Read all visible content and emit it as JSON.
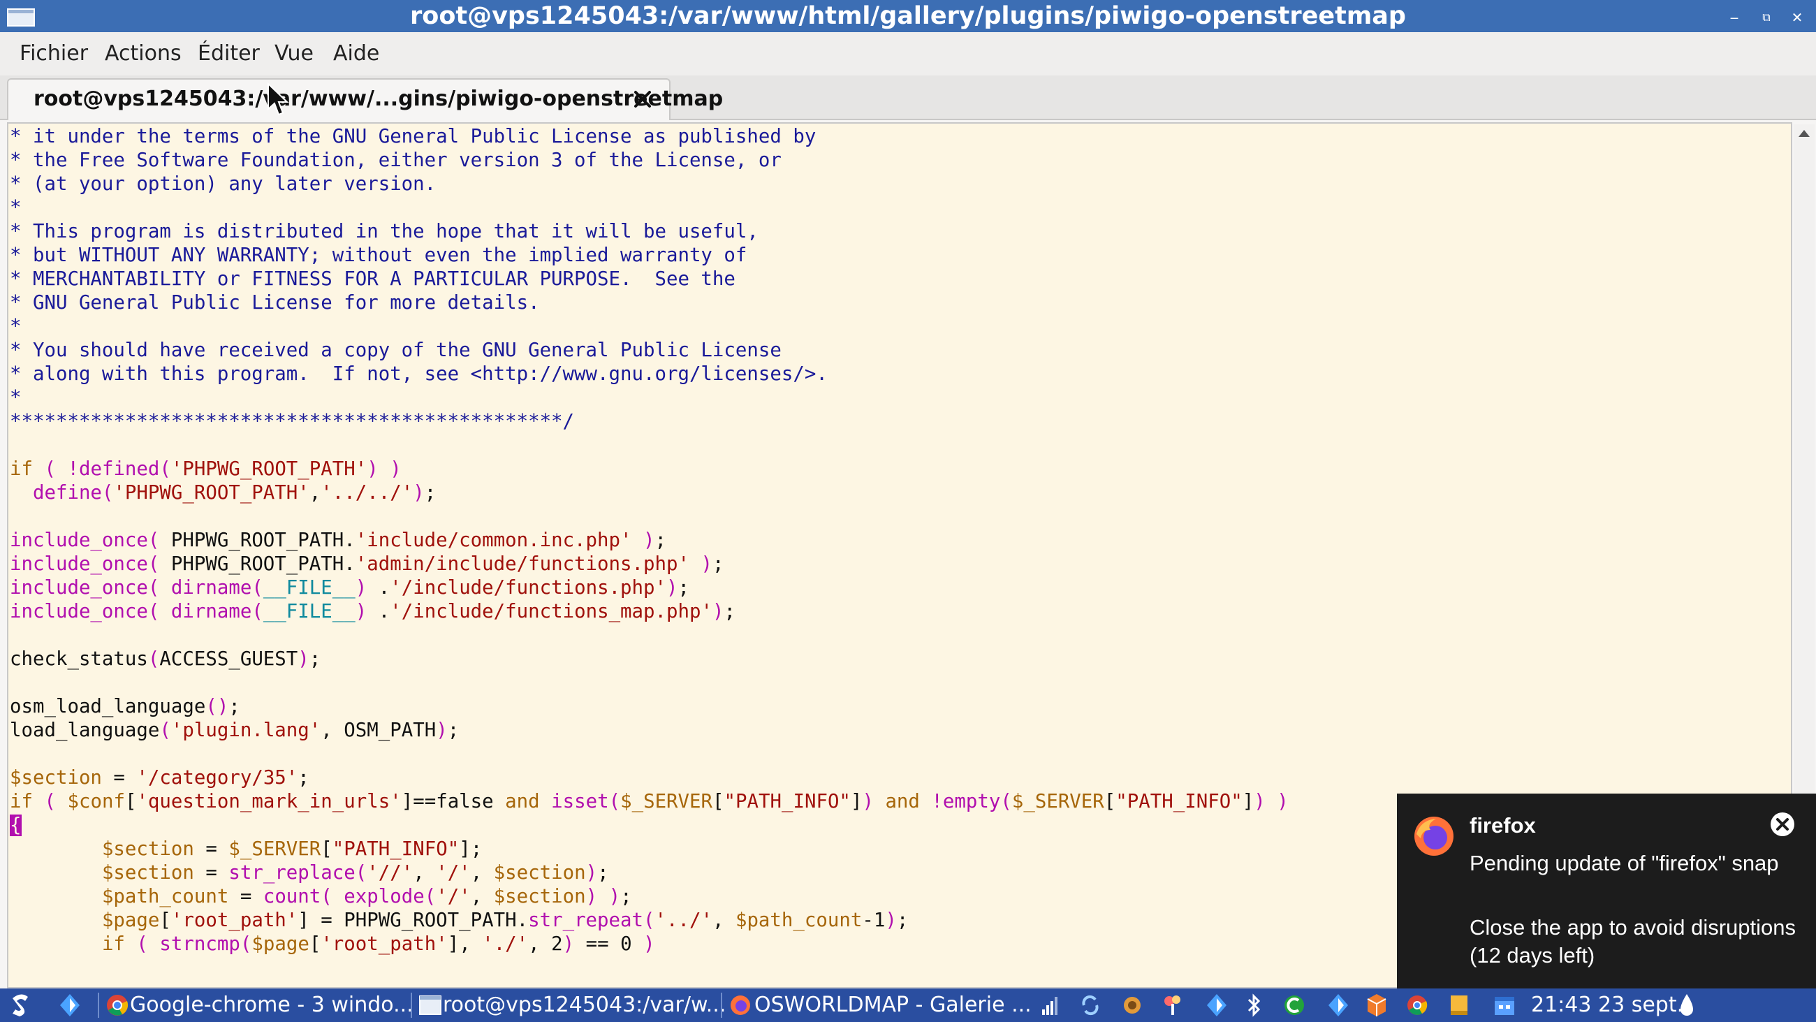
{
  "window": {
    "title": "root@vps1245043:/var/www/html/gallery/plugins/piwigo-openstreetmap"
  },
  "menu": [
    "Fichier",
    "Actions",
    "Éditer",
    "Vue",
    "Aide"
  ],
  "tab": {
    "label": "root@vps1245043:/var/www/...gins/piwigo-openstreetmap"
  },
  "colors": {
    "titlebar": "#3c6eb4",
    "terminal_bg": "#fdf6e3",
    "taskbar": "#2a4ea0",
    "notification_bg": "#1c1c1c"
  },
  "code_lines": [
    [
      [
        "c",
        "* it under the terms of the GNU General Public License as published by"
      ]
    ],
    [
      [
        "c",
        "* the Free Software Foundation, either version 3 of the License, or"
      ]
    ],
    [
      [
        "c",
        "* (at your option) any later version."
      ]
    ],
    [
      [
        "c",
        "*"
      ]
    ],
    [
      [
        "c",
        "* This program is distributed in the hope that it will be useful,"
      ]
    ],
    [
      [
        "c",
        "* but WITHOUT ANY WARRANTY; without even the implied warranty of"
      ]
    ],
    [
      [
        "c",
        "* MERCHANTABILITY or FITNESS FOR A PARTICULAR PURPOSE.  See the"
      ]
    ],
    [
      [
        "c",
        "* GNU General Public License for more details."
      ]
    ],
    [
      [
        "c",
        "*"
      ]
    ],
    [
      [
        "c",
        "* You should have received a copy of the GNU General Public License"
      ]
    ],
    [
      [
        "c",
        "* along with this program.  If not, see <http://www.gnu.org/licenses/>."
      ]
    ],
    [
      [
        "c",
        "*"
      ]
    ],
    [
      [
        "c",
        "************************************************/"
      ]
    ],
    [
      [
        "p",
        ""
      ]
    ],
    [
      [
        "k",
        "if"
      ],
      [
        "p",
        " "
      ],
      [
        "f",
        "("
      ],
      [
        "p",
        " "
      ],
      [
        "f",
        "!defined("
      ],
      [
        "s",
        "'PHPWG_ROOT_PATH'"
      ],
      [
        "f",
        ")"
      ],
      [
        "p",
        " "
      ],
      [
        "f",
        ")"
      ]
    ],
    [
      [
        "p",
        "  "
      ],
      [
        "f",
        "define("
      ],
      [
        "s",
        "'PHPWG_ROOT_PATH'"
      ],
      [
        "p",
        ","
      ],
      [
        "s",
        "'../../'"
      ],
      [
        "f",
        ")"
      ],
      [
        "p",
        ";"
      ]
    ],
    [
      [
        "p",
        ""
      ]
    ],
    [
      [
        "f",
        "include_once("
      ],
      [
        "p",
        " PHPWG_ROOT_PATH."
      ],
      [
        "s",
        "'include/common.inc.php'"
      ],
      [
        "p",
        " "
      ],
      [
        "f",
        ")"
      ],
      [
        "p",
        ";"
      ]
    ],
    [
      [
        "f",
        "include_once("
      ],
      [
        "p",
        " PHPWG_ROOT_PATH."
      ],
      [
        "s",
        "'admin/include/functions.php'"
      ],
      [
        "p",
        " "
      ],
      [
        "f",
        ")"
      ],
      [
        "p",
        ";"
      ]
    ],
    [
      [
        "f",
        "include_once("
      ],
      [
        "p",
        " "
      ],
      [
        "f",
        "dirname("
      ],
      [
        "b",
        "__FILE__"
      ],
      [
        "f",
        ")"
      ],
      [
        "p",
        " ."
      ],
      [
        "s",
        "'/include/functions.php'"
      ],
      [
        "f",
        ")"
      ],
      [
        "p",
        ";"
      ]
    ],
    [
      [
        "f",
        "include_once("
      ],
      [
        "p",
        " "
      ],
      [
        "f",
        "dirname("
      ],
      [
        "b",
        "__FILE__"
      ],
      [
        "f",
        ")"
      ],
      [
        "p",
        " ."
      ],
      [
        "s",
        "'/include/functions_map.php'"
      ],
      [
        "f",
        ")"
      ],
      [
        "p",
        ";"
      ]
    ],
    [
      [
        "p",
        ""
      ]
    ],
    [
      [
        "p",
        "check_status"
      ],
      [
        "f",
        "("
      ],
      [
        "p",
        "ACCESS_GUEST"
      ],
      [
        "f",
        ")"
      ],
      [
        "p",
        ";"
      ]
    ],
    [
      [
        "p",
        ""
      ]
    ],
    [
      [
        "p",
        "osm_load_language"
      ],
      [
        "f",
        "()"
      ],
      [
        "p",
        ";"
      ]
    ],
    [
      [
        "p",
        "load_language"
      ],
      [
        "f",
        "("
      ],
      [
        "s",
        "'plugin.lang'"
      ],
      [
        "p",
        ", OSM_PATH"
      ],
      [
        "f",
        ")"
      ],
      [
        "p",
        ";"
      ]
    ],
    [
      [
        "p",
        ""
      ]
    ],
    [
      [
        "v",
        "$section"
      ],
      [
        "p",
        " = "
      ],
      [
        "s",
        "'/category/35'"
      ],
      [
        "p",
        ";"
      ]
    ],
    [
      [
        "k",
        "if"
      ],
      [
        "p",
        " "
      ],
      [
        "f",
        "("
      ],
      [
        "p",
        " "
      ],
      [
        "v",
        "$conf"
      ],
      [
        "p",
        "["
      ],
      [
        "s",
        "'question_mark_in_urls'"
      ],
      [
        "p",
        "]==false "
      ],
      [
        "k",
        "and"
      ],
      [
        "p",
        " "
      ],
      [
        "f",
        "isset("
      ],
      [
        "v",
        "$_SERVER"
      ],
      [
        "p",
        "["
      ],
      [
        "s",
        "\"PATH_INFO\""
      ],
      [
        "p",
        "]"
      ],
      [
        "f",
        ")"
      ],
      [
        "p",
        " "
      ],
      [
        "k",
        "and"
      ],
      [
        "p",
        " "
      ],
      [
        "f",
        "!empty("
      ],
      [
        "v",
        "$_SERVER"
      ],
      [
        "p",
        "["
      ],
      [
        "s",
        "\"PATH_INFO\""
      ],
      [
        "p",
        "]"
      ],
      [
        "f",
        ")"
      ],
      [
        "p",
        " "
      ],
      [
        "f",
        ")"
      ]
    ],
    [
      [
        "cur",
        "{"
      ]
    ],
    [
      [
        "p",
        "        "
      ],
      [
        "v",
        "$section"
      ],
      [
        "p",
        " = "
      ],
      [
        "v",
        "$_SERVER"
      ],
      [
        "p",
        "["
      ],
      [
        "s",
        "\"PATH_INFO\""
      ],
      [
        "p",
        "];"
      ]
    ],
    [
      [
        "p",
        "        "
      ],
      [
        "v",
        "$section"
      ],
      [
        "p",
        " = "
      ],
      [
        "f",
        "str_replace("
      ],
      [
        "s",
        "'//'"
      ],
      [
        "p",
        ", "
      ],
      [
        "s",
        "'/'"
      ],
      [
        "p",
        ", "
      ],
      [
        "v",
        "$section"
      ],
      [
        "f",
        ")"
      ],
      [
        "p",
        ";"
      ]
    ],
    [
      [
        "p",
        "        "
      ],
      [
        "v",
        "$path_count"
      ],
      [
        "p",
        " = "
      ],
      [
        "f",
        "count("
      ],
      [
        "p",
        " "
      ],
      [
        "f",
        "explode("
      ],
      [
        "s",
        "'/'"
      ],
      [
        "p",
        ", "
      ],
      [
        "v",
        "$section"
      ],
      [
        "f",
        ")"
      ],
      [
        "p",
        " "
      ],
      [
        "f",
        ")"
      ],
      [
        "p",
        ";"
      ]
    ],
    [
      [
        "p",
        "        "
      ],
      [
        "v",
        "$page"
      ],
      [
        "p",
        "["
      ],
      [
        "s",
        "'root_path'"
      ],
      [
        "p",
        "] = PHPWG_ROOT_PATH."
      ],
      [
        "f",
        "str_repeat("
      ],
      [
        "s",
        "'../'"
      ],
      [
        "p",
        ", "
      ],
      [
        "v",
        "$path_count"
      ],
      [
        "p",
        "-1"
      ],
      [
        "f",
        ")"
      ],
      [
        "p",
        ";"
      ]
    ],
    [
      [
        "p",
        "        "
      ],
      [
        "k",
        "if"
      ],
      [
        "p",
        " "
      ],
      [
        "f",
        "("
      ],
      [
        "p",
        " "
      ],
      [
        "f",
        "strncmp("
      ],
      [
        "v",
        "$page"
      ],
      [
        "p",
        "["
      ],
      [
        "s",
        "'root_path'"
      ],
      [
        "p",
        "], "
      ],
      [
        "s",
        "'./'"
      ],
      [
        "p",
        ", 2"
      ],
      [
        "f",
        ")"
      ],
      [
        "p",
        " == 0 "
      ],
      [
        "f",
        ")"
      ]
    ]
  ],
  "notification": {
    "app_name": "firefox",
    "line1": "Pending update of \"firefox\" snap",
    "line2": "Close the app to avoid disruptions (12 days left)"
  },
  "taskbar": {
    "tasks": [
      {
        "label": "Google-chrome - 3 windo...",
        "icon": "chrome-icon"
      },
      {
        "label": "root@vps1245043:/var/w...",
        "icon": "terminal-icon"
      },
      {
        "label": "OSWORLDMAP - Galerie ...",
        "icon": "firefox-icon"
      }
    ],
    "clock": "21:43 23 sept."
  }
}
